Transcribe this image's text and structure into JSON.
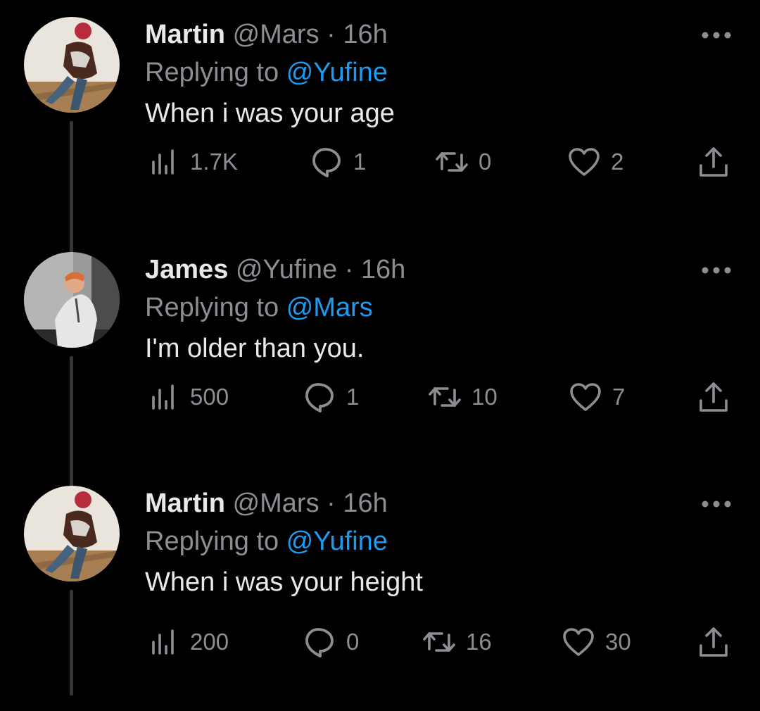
{
  "colors": {
    "background": "#000000",
    "primary_text": "#e7e9ea",
    "secondary_text": "#8b8f94",
    "mention": "#1d9bf0",
    "thread_line": "#333639"
  },
  "icons": {
    "views": "bar-chart-icon",
    "reply": "speech-bubble-icon",
    "retweet": "retweet-icon",
    "like": "heart-icon",
    "share": "share-icon",
    "more": "more-dots-icon"
  },
  "tweets": [
    {
      "name": "Martin",
      "handle": "@Mars",
      "dot": "·",
      "time": "16h",
      "replying_prefix": "Replying to",
      "replying_to": "@Yufine",
      "text": "When i was your age",
      "views": "1.7K",
      "replies": "1",
      "retweets": "0",
      "likes": "2"
    },
    {
      "name": "James",
      "handle": "@Yufine",
      "dot": "·",
      "time": "16h",
      "replying_prefix": "Replying to",
      "replying_to": "@Mars",
      "text": "I'm older than you.",
      "views": "500",
      "replies": "1",
      "retweets": "10",
      "likes": "7"
    },
    {
      "name": "Martin",
      "handle": "@Mars",
      "dot": "·",
      "time": "16h",
      "replying_prefix": "Replying to",
      "replying_to": "@Yufine",
      "text": "When i was your height",
      "views": "200",
      "replies": "0",
      "retweets": "16",
      "likes": "30"
    }
  ]
}
